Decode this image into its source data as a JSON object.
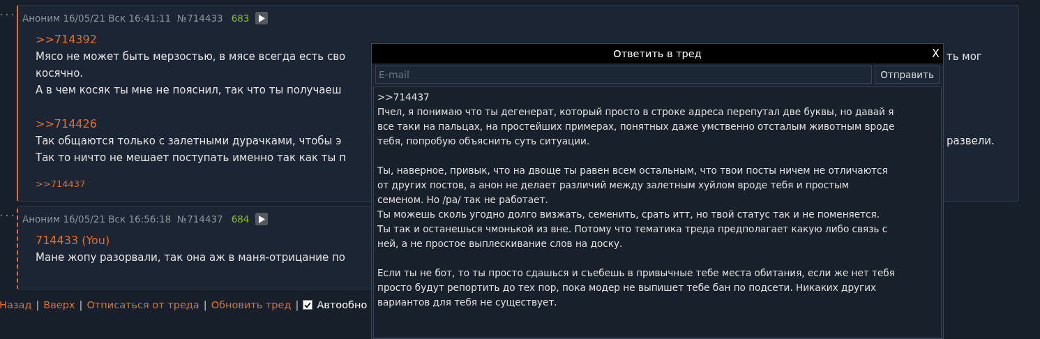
{
  "posts": [
    {
      "author": "Аноним",
      "date": "16/05/21 Вск 16:41:11",
      "number": "№714433",
      "count": "683",
      "highlighted": false,
      "blocks": [
        {
          "kind": "link",
          "text": ">>714392"
        },
        {
          "kind": "text",
          "lines": [
            {
              "left": "Мясо не может быть мерзостью, в мясе всегда есть сво",
              "right": "ть мог"
            },
            {
              "left": "косячно."
            },
            {
              "left": "А в чем косяк ты мне не пояснил, так что ты получаеш"
            }
          ]
        },
        {
          "kind": "link",
          "text": ">>714426"
        },
        {
          "kind": "text",
          "lines": [
            {
              "left": "Так общаются только с залетными дурачками, чтобы э",
              "right": "развели."
            },
            {
              "left": "Так то ничто не мешает поступать именно так как ты п"
            }
          ]
        },
        {
          "kind": "backlink",
          "text": ">>714437"
        }
      ]
    },
    {
      "author": "Аноним",
      "date": "16/05/21 Вск 16:56:18",
      "number": "№714437",
      "count": "684",
      "highlighted": true,
      "blocks": [
        {
          "kind": "link",
          "text": "714433 (You)"
        },
        {
          "kind": "text",
          "lines": [
            {
              "left": "Мане жопу разорвали, так она аж в маня-отрицание по"
            }
          ]
        }
      ]
    }
  ],
  "footer": {
    "items": [
      {
        "kind": "link",
        "text": "Назад"
      },
      {
        "kind": "sep",
        "text": "|"
      },
      {
        "kind": "link",
        "text": "Вверх"
      },
      {
        "kind": "sep",
        "text": "|"
      },
      {
        "kind": "link",
        "text": "Отписаться от треда"
      },
      {
        "kind": "sep",
        "text": "|"
      },
      {
        "kind": "link",
        "text": "Обновить тред"
      },
      {
        "kind": "sep",
        "text": "|"
      }
    ],
    "autoupdate": {
      "label": "Автообно",
      "checked": true
    }
  },
  "reply_window": {
    "title": "Ответить в тред",
    "close": "X",
    "email": {
      "placeholder": "E-mail"
    },
    "submit": "Отправить",
    "message": [
      [
        ">>714437",
        "Пчел, я понимаю что ты дегенерат, который просто в строке адреса перепутал две буквы, но давай я",
        "все таки на пальцах, на простейших примерах, понятных даже умственно отсталым животным вроде",
        "тебя, попробую объяснить суть ситуации."
      ],
      [
        "Ты, наверное, привык, что на двоще ты равен всем остальным, что твои посты ничем не отличаются",
        "от других постов, а анон не делает различий между залетным хуйлом вроде тебя и простым",
        "семеном. Но /pa/ так не работает.",
        "Ты можешь сколь угодно долго визжать, семенить, срать итт, но твой статус так и не поменяется.",
        "Ты так и останешься чмонькой из вне. Потому что тематика треда предполагает какую либо связь с",
        "ней, а не простое выплескивание слов на доску."
      ],
      [
        "Если ты не бот, то ты просто сдашься и съебешь в привычные тебе места обитания, если же нет тебя",
        "просто будут репортить до тех пор, пока модер не выпишет тебе бан по подсети. Никаких других",
        "вариантов для тебя не существует."
      ]
    ]
  }
}
